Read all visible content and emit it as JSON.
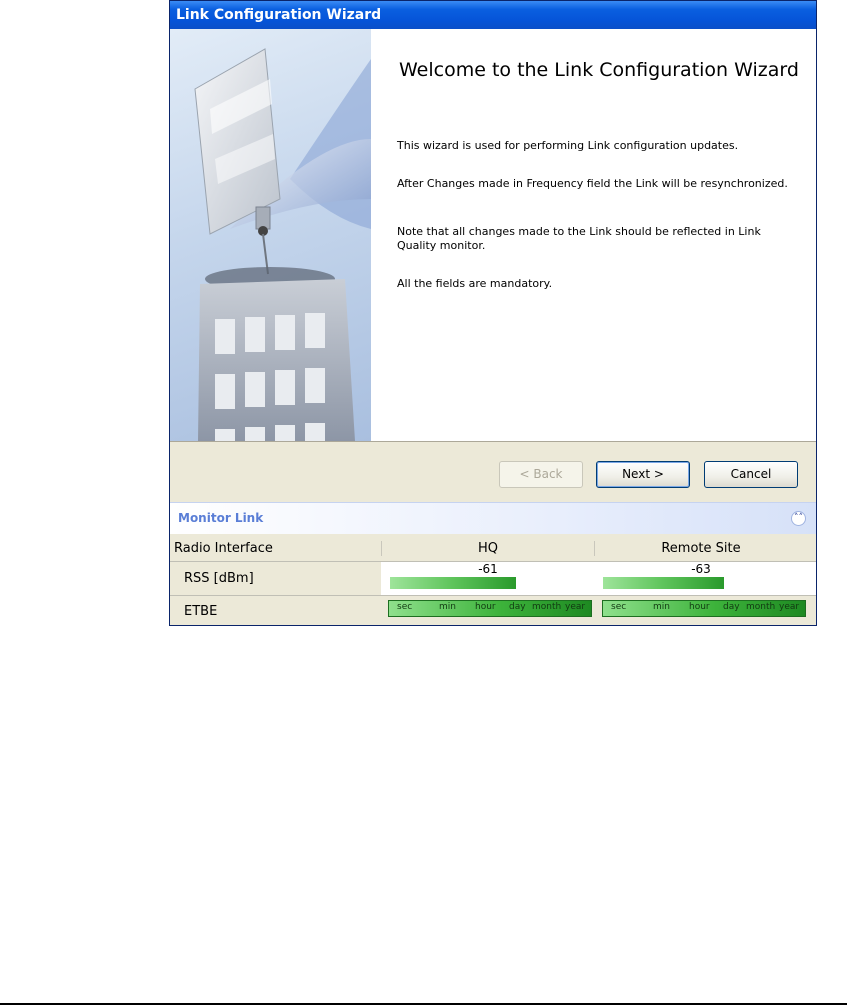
{
  "window": {
    "title": "Link Configuration Wizard"
  },
  "content": {
    "heading": "Welcome to the Link Configuration Wizard",
    "paragraphs": [
      "This wizard is used for performing Link configuration updates.",
      "After Changes made in Frequency field the Link will be resynchronized.",
      "Note that all changes made to the Link should be reflected in Link Quality monitor.",
      "All the fields are mandatory."
    ]
  },
  "buttons": {
    "back": "< Back",
    "next": "Next >",
    "cancel": "Cancel"
  },
  "monitor": {
    "title": "Monitor Link",
    "columns": [
      "Radio Interface",
      "HQ",
      "Remote Site"
    ],
    "rss": {
      "label": "RSS [dBm]",
      "hq": "-61",
      "remote": "-63"
    },
    "etbe": {
      "label": "ETBE",
      "scale": [
        "sec",
        "min",
        "hour",
        "day",
        "month",
        "year"
      ]
    }
  },
  "icons": {
    "collapse": "double-chevron-up-icon"
  }
}
